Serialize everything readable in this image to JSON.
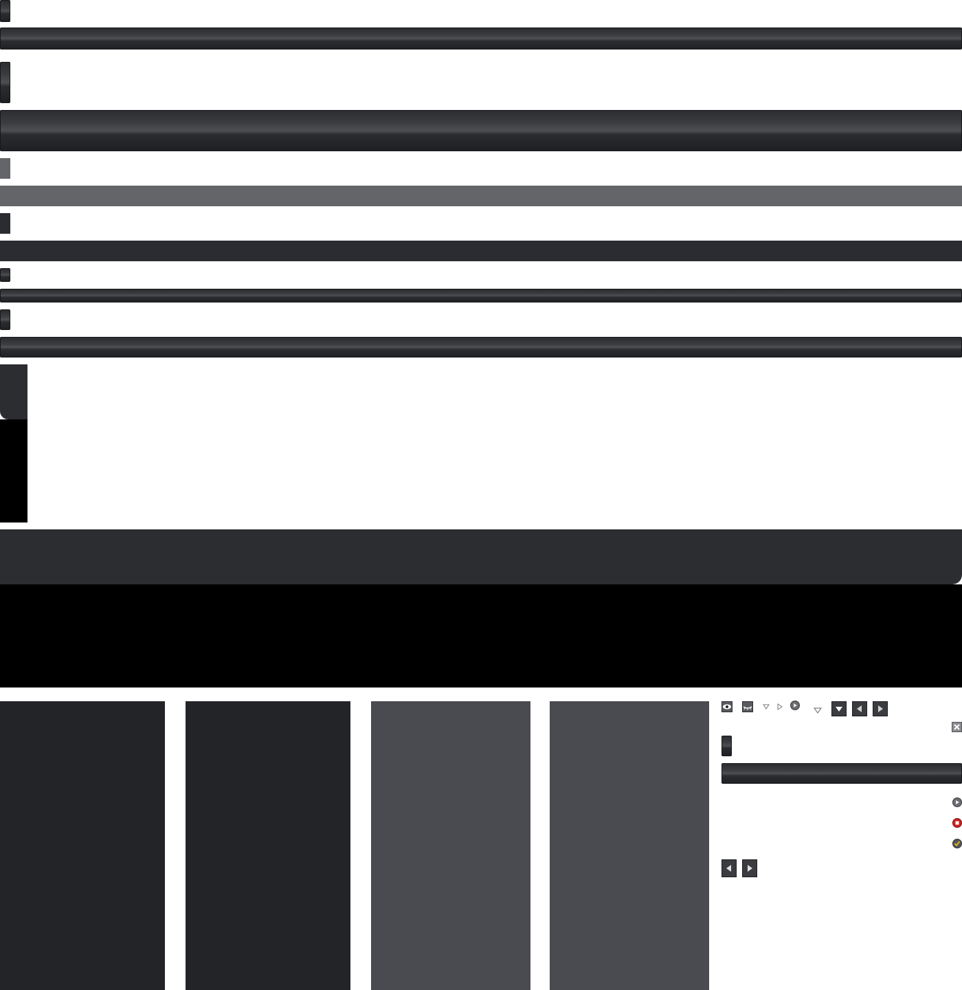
{
  "page": {
    "background": "#ffffff"
  },
  "colors": {
    "glossy_dark": "#2b2d30",
    "flat_mid": "#646569",
    "flat_dark": "#2a2c31",
    "panel_a": "#222428",
    "panel_b": "#494b50",
    "black": "#000000"
  },
  "toolbar_icons": [
    {
      "name": "eye-icon"
    },
    {
      "name": "eye-closed-icon"
    },
    {
      "name": "triangle-down-icon"
    },
    {
      "name": "triangle-right-icon"
    },
    {
      "name": "play-circle-icon"
    },
    {
      "name": "small-triangle-down-icon"
    },
    {
      "name": "dropdown-arrow-button-icon"
    },
    {
      "name": "arrow-left-button-icon"
    },
    {
      "name": "arrow-right-button-icon"
    }
  ],
  "status_icons": [
    {
      "name": "play-status-icon",
      "color": "#6c6d70"
    },
    {
      "name": "stop-status-icon",
      "color": "#cc2222"
    },
    {
      "name": "check-status-icon",
      "color": "#d4a21a"
    }
  ],
  "close_icon": {
    "name": "close-icon"
  }
}
